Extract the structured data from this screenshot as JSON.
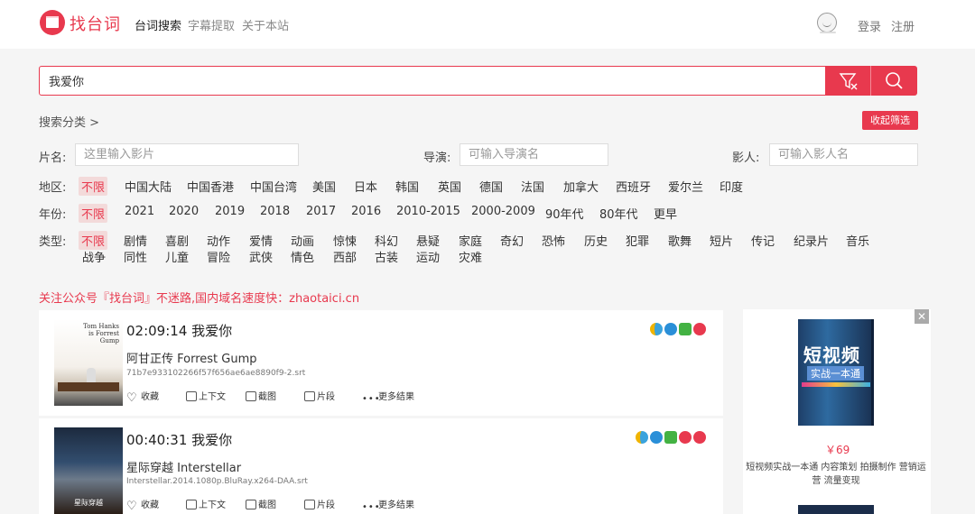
{
  "brand": {
    "name": "找台词",
    "color": "#e8394e"
  },
  "nav": {
    "items": [
      "台词搜索",
      "字幕提取",
      "关于本站"
    ],
    "active": 0
  },
  "user": {
    "login": "登录",
    "register": "注册"
  },
  "search": {
    "value": "我爱你",
    "filter_icon": "filter-icon",
    "search_icon": "search-icon"
  },
  "filters": {
    "category_label": "搜索分类 >",
    "collapse_label": "收起筛选",
    "title_label": "片名:",
    "title_placeholder": "这里输入影片",
    "director_label": "导演:",
    "director_placeholder": "可输入导演名",
    "actor_label": "影人:",
    "actor_placeholder": "可输入影人名",
    "region_label": "地区:",
    "region": [
      "不限",
      "中国大陆",
      "中国香港",
      "中国台湾",
      "美国",
      "日本",
      "韩国",
      "英国",
      "德国",
      "法国",
      "加拿大",
      "西班牙",
      "爱尔兰",
      "印度"
    ],
    "year_label": "年份:",
    "year": [
      "不限",
      "2021",
      "2020",
      "2019",
      "2018",
      "2017",
      "2016",
      "2010-2015",
      "2000-2009",
      "90年代",
      "80年代",
      "更早"
    ],
    "genre_label": "类型:",
    "genre_row1": [
      "不限",
      "剧情",
      "喜剧",
      "动作",
      "爱情",
      "动画",
      "惊悚",
      "科幻",
      "悬疑",
      "家庭",
      "奇幻",
      "恐怖",
      "历史",
      "犯罪",
      "歌舞",
      "短片",
      "传记",
      "纪录片",
      "音乐"
    ],
    "genre_row2": [
      "战争",
      "同性",
      "儿童",
      "冒险",
      "武侠",
      "情色",
      "西部",
      "古装",
      "运动",
      "灾难"
    ]
  },
  "notice": "关注公众号『找台词』不迷路,国内域名速度快：zhaotaici.cn",
  "results": [
    {
      "time": "02:09:14",
      "quote": "我爱你",
      "title": "阿甘正传 Forrest Gump",
      "file": "71b7e933102266f57f656ae6ae8890f9-2.srt",
      "poster_text": "Tom Hanks is Forrest Gump"
    },
    {
      "time": "00:40:31",
      "quote": "我爱你",
      "title": "星际穿越 Interstellar",
      "file": "Interstellar.2014.1080p.BluRay.x264-DAA.srt",
      "poster_text": "星际穿越"
    }
  ],
  "actions": {
    "fav": "收藏",
    "context": "上下文",
    "shot": "截图",
    "clip": "片段",
    "more": "更多结果"
  },
  "ad": {
    "close": "✕",
    "book_title": "短视频",
    "book_sub": "实战一本通",
    "price": "￥69",
    "desc": "短视频实战一本通 内容策划 拍摄制作 营销运营 流量变现"
  }
}
